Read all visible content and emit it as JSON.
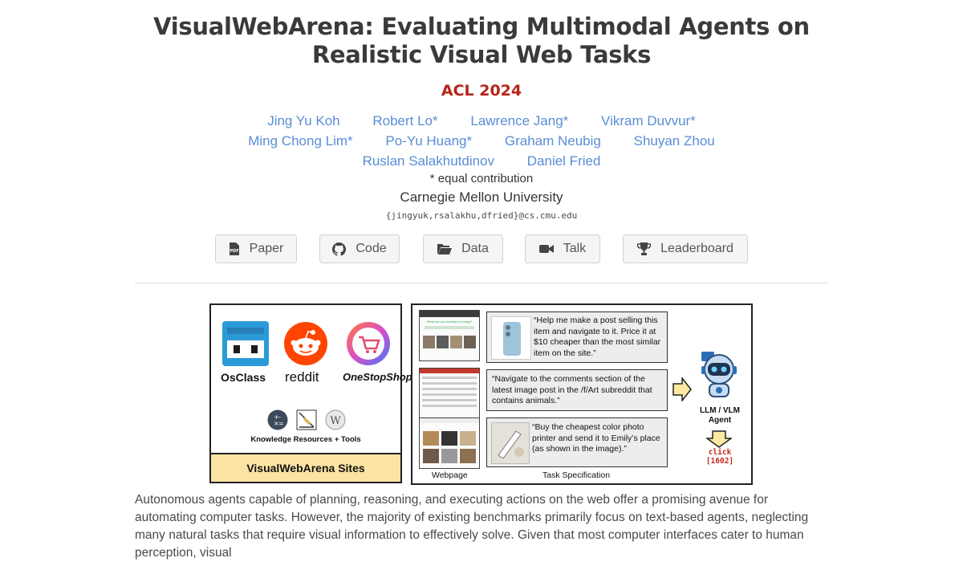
{
  "paper": {
    "title": "VisualWebArena: Evaluating Multimodal Agents on Realistic Visual Web Tasks",
    "venue": "ACL 2024",
    "authors_row1": [
      "Jing Yu Koh",
      "Robert Lo*",
      "Lawrence Jang*",
      "Vikram Duvvur*"
    ],
    "authors_row2": [
      "Ming Chong Lim*",
      "Po-Yu Huang*",
      "Graham Neubig",
      "Shuyan Zhou"
    ],
    "authors_row3": [
      "Ruslan Salakhutdinov",
      "Daniel Fried"
    ],
    "equal_contribution": "* equal contribution",
    "affiliation": "Carnegie Mellon University",
    "email": "{jingyuk,rsalakhu,dfried}@cs.cmu.edu"
  },
  "links": {
    "paper": "Paper",
    "code": "Code",
    "data": "Data",
    "talk": "Talk",
    "leaderboard": "Leaderboard"
  },
  "figure": {
    "sites": {
      "osclass": "OsClass",
      "reddit": "reddit",
      "onestopshop": "OneStopShop",
      "knowledge": "Knowledge Resources + Tools",
      "footer": "VisualWebArena Sites"
    },
    "tasks": [
      "“Help me make a post selling this item and navigate to it. Price it at $10 cheaper than the most similar item on the site.”",
      "“Navigate to the comments section of the latest image post in the /f/Art subreddit that contains animals.”",
      "“Buy the cheapest color photo printer and send it to Emily’s place (as shown in the image).”"
    ],
    "agent_label_1": "LLM / VLM",
    "agent_label_2": "Agent",
    "action_1": "click",
    "action_2": "[1602]",
    "caption_webpage": "Webpage",
    "caption_task": "Task Specification",
    "thumb_heading": "What are you looking for today?"
  },
  "abstract": "Autonomous agents capable of planning, reasoning, and executing actions on the web offer a promising avenue for automating computer tasks. However, the majority of existing benchmarks primarily focus on text-based agents, neglecting many natural tasks that require visual information to effectively solve. Given that most computer interfaces cater to human perception, visual",
  "colors": {
    "title": "#3a3a3a",
    "venue": "#b5251b",
    "author_link": "#5a8dd6",
    "button_bg": "#f5f5f5",
    "sites_footer": "#fbe3a3"
  }
}
